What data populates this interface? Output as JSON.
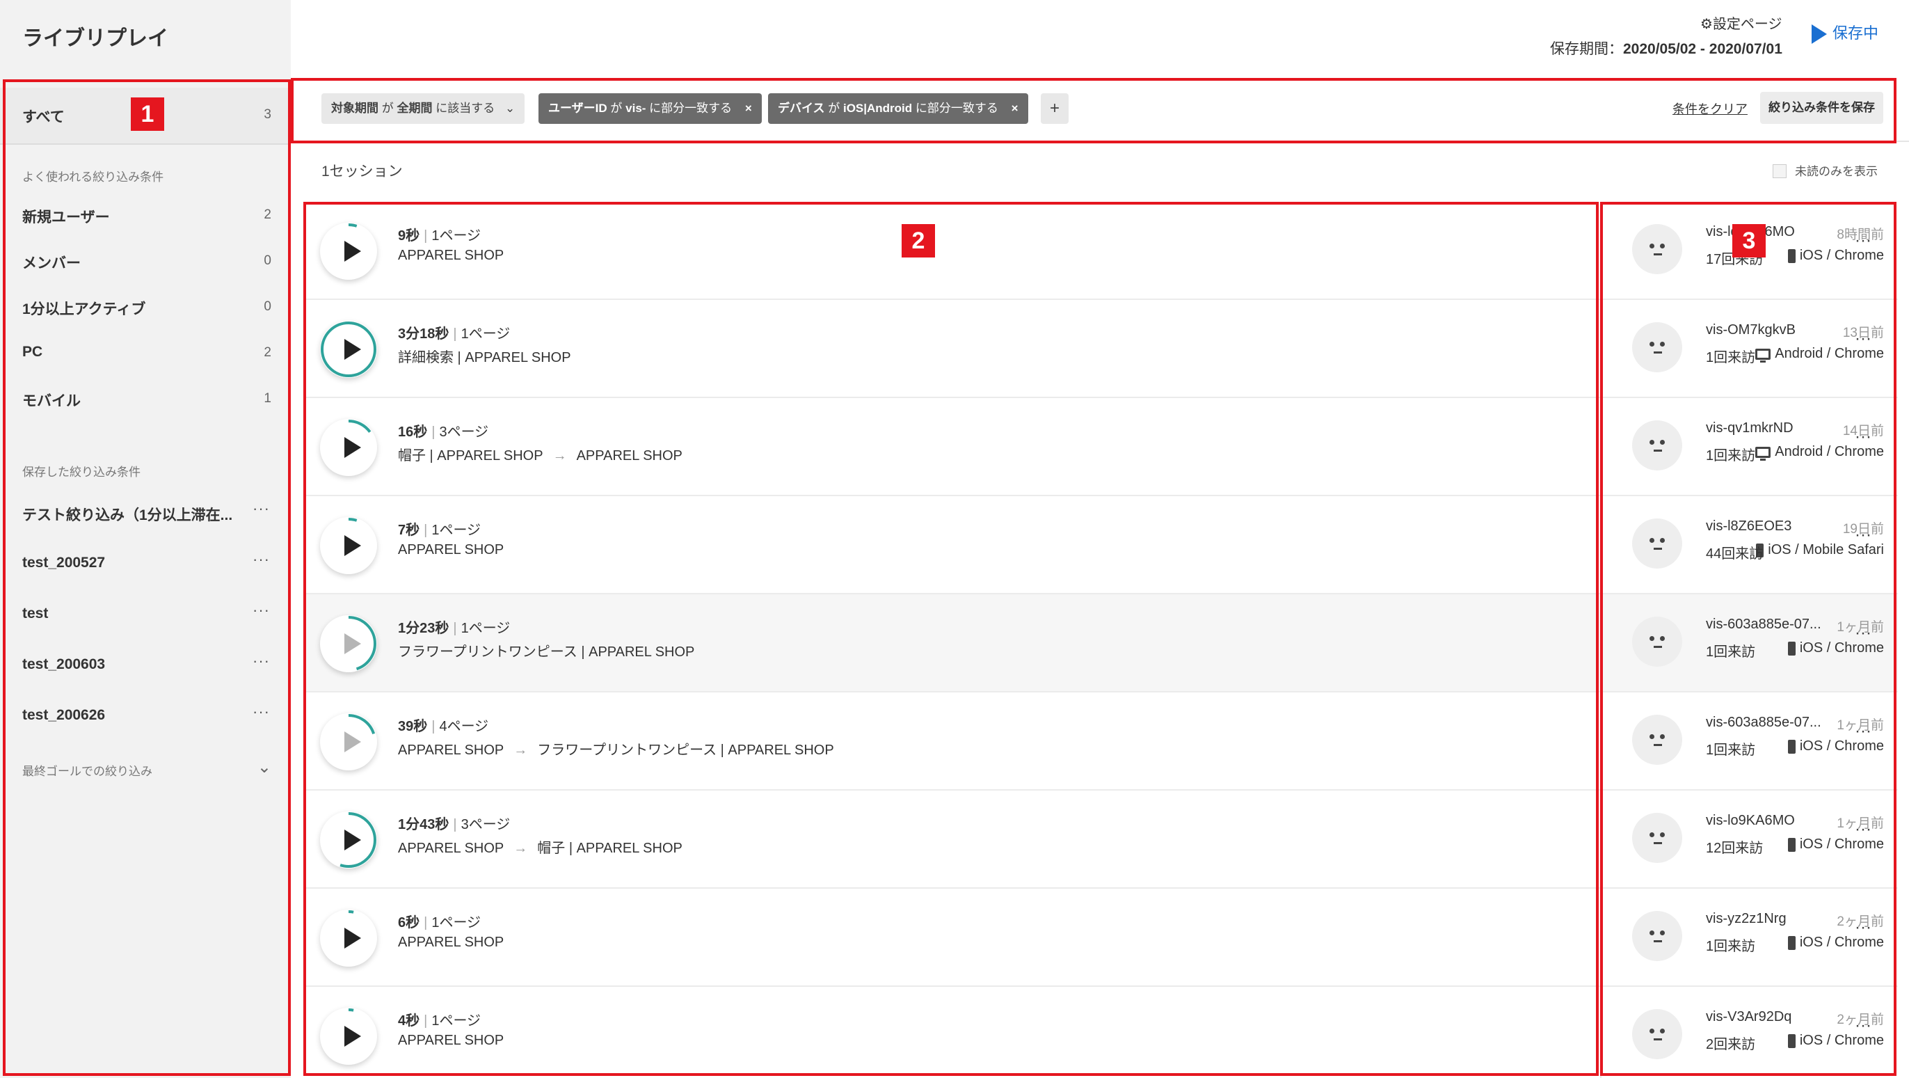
{
  "app_title": "ライブリプレイ",
  "header": {
    "settings_label": "設定ページ",
    "period_label": "保存期間：",
    "period_value": "2020/05/02 - 2020/07/01",
    "saving_label": "保存中"
  },
  "sidebar": {
    "all": {
      "label": "すべて",
      "count": "3"
    },
    "frequent_heading": "よく使われる絞り込み条件",
    "frequent": [
      {
        "label": "新規ユーザー",
        "count": "2"
      },
      {
        "label": "メンバー",
        "count": "0"
      },
      {
        "label": "1分以上アクティブ",
        "count": "0"
      },
      {
        "label": "PC",
        "count": "2"
      },
      {
        "label": "モバイル",
        "count": "1"
      }
    ],
    "saved_heading": "保存した絞り込み条件",
    "saved": [
      {
        "label": "テスト絞り込み（1分以上滞在...",
        "more": "···"
      },
      {
        "label": "test_200527",
        "more": "···"
      },
      {
        "label": "test",
        "more": "···"
      },
      {
        "label": "test_200603",
        "more": "···"
      },
      {
        "label": "test_200626",
        "more": "···"
      }
    ],
    "goal_filter": "最終ゴールでの絞り込み"
  },
  "filters": {
    "chips": [
      {
        "field": "対象期間",
        "op": "が",
        "value": "全期間",
        "tail": "に該当する"
      },
      {
        "field": "ユーザーID",
        "op": "が",
        "value": "vis-",
        "tail": "に部分一致する"
      },
      {
        "field": "デバイス",
        "op": "が",
        "value": "iOS|Android",
        "tail": "に部分一致する"
      }
    ],
    "add_label": "+",
    "clear_label": "条件をクリア",
    "save_label": "絞り込み条件を保存"
  },
  "summary": {
    "session_count": "1セッション",
    "unread_only": "未読のみを表示"
  },
  "sessions": [
    {
      "duration": "9秒",
      "pages": "1ページ",
      "path": [
        "APPAREL SHOP"
      ],
      "when": "8時間前",
      "device": "iOS / Chrome",
      "device_type": "phone",
      "progress": 0.05,
      "visitor_id": "vis-lo9KA6MO",
      "visits": "17回来訪"
    },
    {
      "duration": "3分18秒",
      "pages": "1ページ",
      "path": [
        "詳細検索 | APPAREL SHOP"
      ],
      "when": "13日前",
      "device": "Android / Chrome",
      "device_type": "pc",
      "progress": 1.0,
      "visitor_id": "vis-OM7kgkvB",
      "visits": "1回来訪"
    },
    {
      "duration": "16秒",
      "pages": "3ページ",
      "path": [
        "帽子 | APPAREL SHOP",
        "APPAREL SHOP"
      ],
      "when": "14日前",
      "device": "Android / Chrome",
      "device_type": "pc",
      "progress": 0.15,
      "visitor_id": "vis-qv1mkrND",
      "visits": "1回来訪"
    },
    {
      "duration": "7秒",
      "pages": "1ページ",
      "path": [
        "APPAREL SHOP"
      ],
      "when": "19日前",
      "device": "iOS / Mobile Safari",
      "device_type": "phone",
      "progress": 0.05,
      "visitor_id": "vis-l8Z6EOE3",
      "visits": "44回来訪"
    },
    {
      "duration": "1分23秒",
      "pages": "1ページ",
      "path": [
        "フラワープリントワンピース | APPAREL SHOP"
      ],
      "when": "1ヶ月前",
      "device": "iOS / Chrome",
      "device_type": "phone",
      "progress": 0.45,
      "visitor_id": "vis-603a885e-07...",
      "visits": "1回来訪",
      "grey": true,
      "highlight": true
    },
    {
      "duration": "39秒",
      "pages": "4ページ",
      "path": [
        "APPAREL SHOP",
        "フラワープリントワンピース | APPAREL SHOP"
      ],
      "when": "1ヶ月前",
      "device": "iOS / Chrome",
      "device_type": "phone",
      "progress": 0.2,
      "visitor_id": "vis-603a885e-07...",
      "visits": "1回来訪",
      "grey": true
    },
    {
      "duration": "1分43秒",
      "pages": "3ページ",
      "path": [
        "APPAREL SHOP",
        "帽子 | APPAREL SHOP"
      ],
      "when": "1ヶ月前",
      "device": "iOS / Chrome",
      "device_type": "phone",
      "progress": 0.55,
      "visitor_id": "vis-lo9KA6MO",
      "visits": "12回来訪"
    },
    {
      "duration": "6秒",
      "pages": "1ページ",
      "path": [
        "APPAREL SHOP"
      ],
      "when": "2ヶ月前",
      "device": "iOS / Chrome",
      "device_type": "phone",
      "progress": 0.03,
      "visitor_id": "vis-yz2z1Nrg",
      "visits": "1回来訪"
    },
    {
      "duration": "4秒",
      "pages": "1ページ",
      "path": [
        "APPAREL SHOP"
      ],
      "when": "2ヶ月前",
      "device": "iOS / Chrome",
      "device_type": "phone",
      "progress": 0.03,
      "visitor_id": "vis-V3Ar92Dq",
      "visits": "2回来訪"
    }
  ],
  "annotations": [
    "1",
    "2",
    "3"
  ],
  "colors": {
    "accent": "#1a6fd1",
    "ring": "#2ea39b",
    "annotation": "#e5161f"
  }
}
